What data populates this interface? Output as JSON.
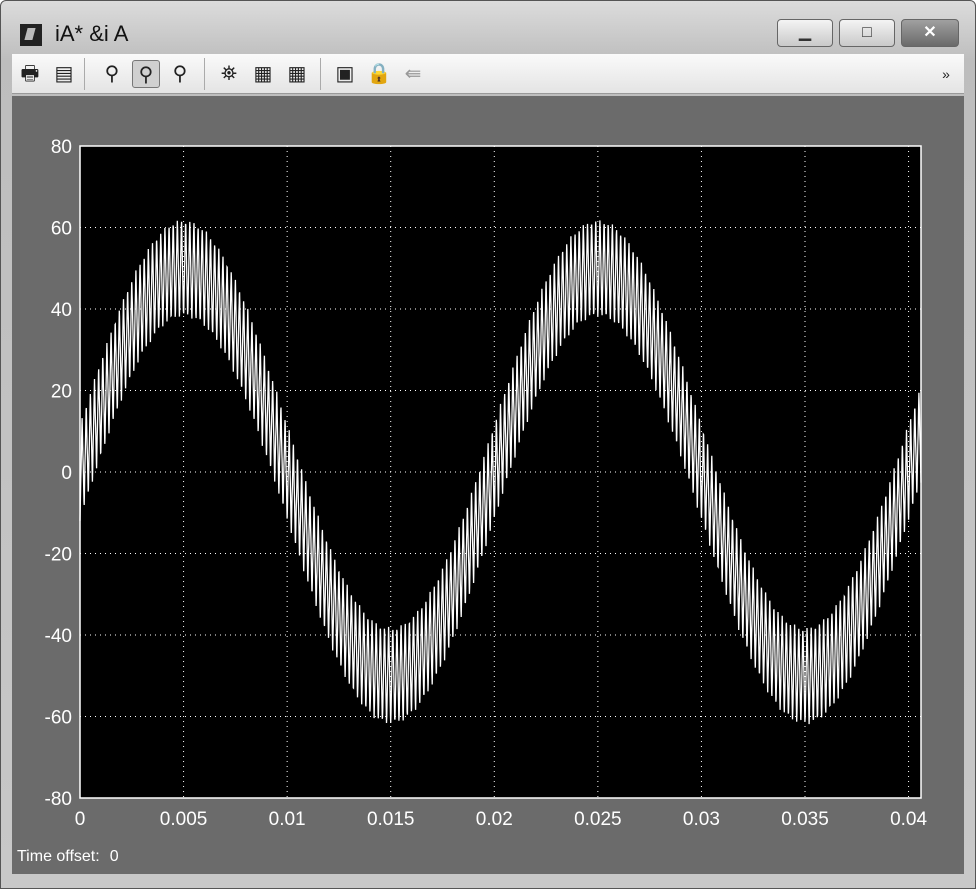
{
  "window": {
    "title": "iA* &i A",
    "minimize": "▁",
    "maximize": "□",
    "close": "✕"
  },
  "toolbar": {
    "items": [
      {
        "name": "print-icon",
        "glyph": "🖶"
      },
      {
        "name": "parameters-icon",
        "glyph": "▤"
      },
      {
        "name": "zoom-icon",
        "glyph": "⚲"
      },
      {
        "name": "zoom-x-icon",
        "glyph": "⚲",
        "active": true
      },
      {
        "name": "zoom-y-icon",
        "glyph": "⚲"
      },
      {
        "name": "autoscale-binoculars-icon",
        "glyph": "⛯"
      },
      {
        "name": "save-axes-icon",
        "glyph": "▦"
      },
      {
        "name": "restore-axes-icon",
        "glyph": "▦"
      },
      {
        "name": "floating-scope-icon",
        "glyph": "▣"
      },
      {
        "name": "lock-axes-icon",
        "glyph": "🔒"
      },
      {
        "name": "signal-selection-icon",
        "glyph": "⇚"
      }
    ],
    "overflow": "»"
  },
  "time_offset": {
    "label": "Time offset:",
    "value": "0"
  },
  "chart_data": {
    "type": "line",
    "title": "",
    "xlabel": "",
    "ylabel": "",
    "xlim": [
      0,
      0.0406
    ],
    "ylim": [
      -80,
      80
    ],
    "xticks": [
      0,
      0.005,
      0.01,
      0.015,
      0.02,
      0.025,
      0.03,
      0.035,
      0.04
    ],
    "xtick_labels": [
      "0",
      "0.005",
      "0.01",
      "0.015",
      "0.02",
      "0.025",
      "0.03",
      "0.035",
      "0.04"
    ],
    "yticks": [
      80,
      60,
      40,
      20,
      0,
      -20,
      -40,
      -60,
      -80
    ],
    "ytick_labels": [
      "80",
      "60",
      "40",
      "20",
      "0",
      "-20",
      "-40",
      "-60",
      "-80"
    ],
    "grid": true,
    "series": [
      {
        "name": "iA",
        "fundamental_amplitude": 50,
        "fundamental_frequency_hz": 50,
        "ripple_amplitude": 12,
        "ripple_frequency_hz": 5000,
        "color": "#ffffff"
      }
    ],
    "background": "#000000",
    "grid_color": "#ffffff"
  }
}
